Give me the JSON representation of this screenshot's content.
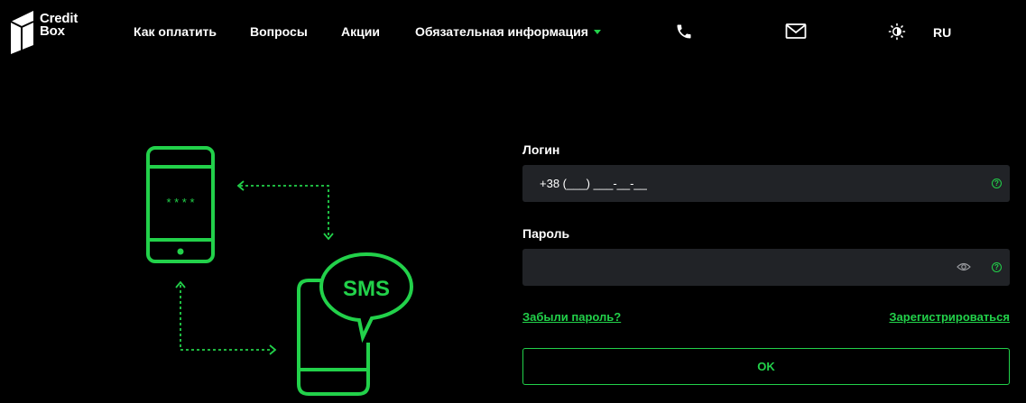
{
  "logo": {
    "line1": "Credit",
    "line2": "Box"
  },
  "nav": {
    "items": [
      {
        "label": "Как оплатить"
      },
      {
        "label": "Вопросы"
      },
      {
        "label": "Акции"
      },
      {
        "label": "Обязательная информация"
      }
    ]
  },
  "header": {
    "icons": [
      "phone-icon",
      "mail-icon",
      "theme-toggle-icon"
    ],
    "language": "RU"
  },
  "illustration": {
    "phone_pin": "* * * *",
    "bubble_text": "SMS"
  },
  "form": {
    "login_label": "Логин",
    "login_value": "+38 (___) ___-__-__",
    "password_label": "Пароль",
    "password_value": "",
    "forgot_link": "Забыли пароль?",
    "register_link": "Зарегистрироваться",
    "submit_label": "OK"
  },
  "colors": {
    "accent": "#22d14a",
    "background": "#000000",
    "field_bg": "#212327"
  }
}
